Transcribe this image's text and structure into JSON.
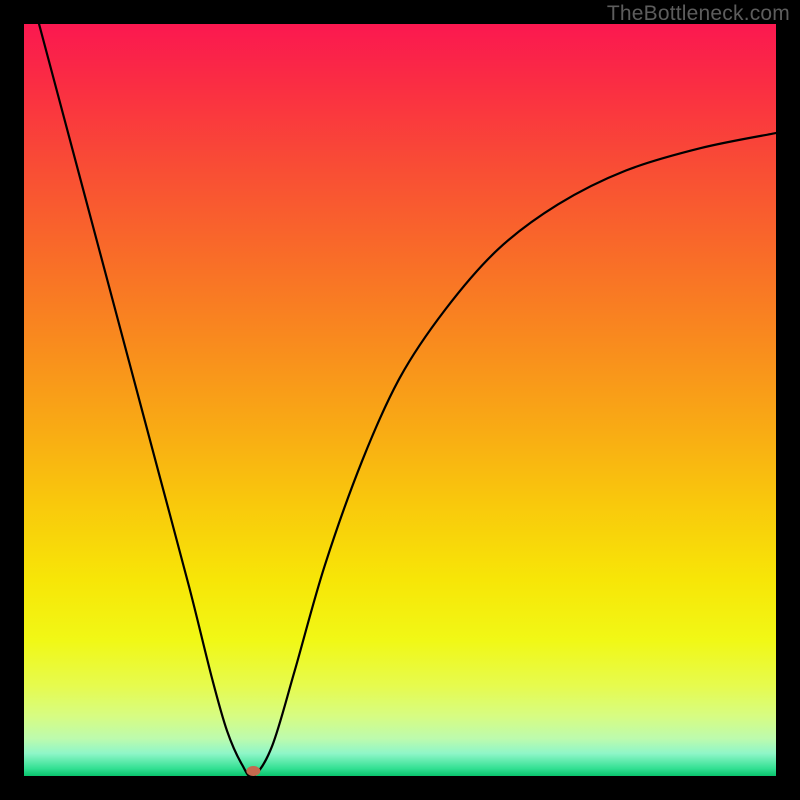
{
  "watermark": "TheBottleneck.com",
  "chart_data": {
    "type": "line",
    "title": "",
    "xlabel": "",
    "ylabel": "",
    "xlim": [
      0,
      100
    ],
    "ylim": [
      0,
      100
    ],
    "grid": false,
    "legend": false,
    "background_gradient": {
      "direction": "vertical",
      "stops": [
        {
          "pos": 0.0,
          "color": "#fb1850"
        },
        {
          "pos": 0.3,
          "color": "#f96a29"
        },
        {
          "pos": 0.64,
          "color": "#f9c90c"
        },
        {
          "pos": 0.82,
          "color": "#f1f816"
        },
        {
          "pos": 0.95,
          "color": "#bdfbad"
        },
        {
          "pos": 1.0,
          "color": "#09c36d"
        }
      ]
    },
    "series": [
      {
        "name": "curve",
        "x": [
          2,
          6,
          10,
          14,
          18,
          22,
          25,
          27,
          29,
          30.5,
          33,
          36,
          40,
          45,
          50,
          56,
          63,
          71,
          80,
          90,
          100
        ],
        "values": [
          100,
          85,
          70,
          55,
          40,
          25,
          13,
          6,
          1.5,
          0,
          4,
          14,
          28,
          42,
          53,
          62,
          70,
          76,
          80.5,
          83.5,
          85.5
        ]
      }
    ],
    "marker": {
      "x": 30.5,
      "y": 0,
      "color": "#c46a4f"
    }
  }
}
